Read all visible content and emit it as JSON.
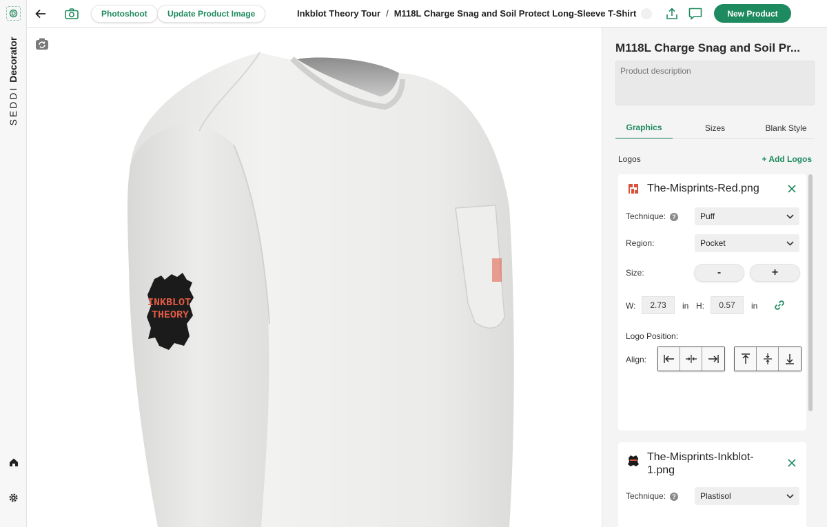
{
  "rail": {
    "brand_light": "SEDDI",
    "brand_bold": "Decorator"
  },
  "topbar": {
    "photoshoot_label": "Photoshoot",
    "update_image_label": "Update Product Image",
    "breadcrumb_collection": "Inkblot Theory Tour",
    "breadcrumb_separator": "/",
    "breadcrumb_product": "M118L Charge Snag and Soil Protect Long-Sleeve T-Shirt",
    "new_product_label": "New Product"
  },
  "viewer": {
    "sleeve_logo_line1": "INKBLOT",
    "sleeve_logo_line2": "THEORY"
  },
  "panel": {
    "title": "M118L Charge Snag and Soil Pr...",
    "description_placeholder": "Product description",
    "tabs": [
      {
        "label": "Graphics",
        "active": true
      },
      {
        "label": "Sizes",
        "active": false
      },
      {
        "label": "Blank Style",
        "active": false
      }
    ],
    "logos_label": "Logos",
    "add_logos_label": "+ Add Logos",
    "logos": [
      {
        "filename": "The-Misprints-Red.png",
        "technique_label": "Technique:",
        "technique": "Puff",
        "region_label": "Region:",
        "region": "Pocket",
        "size_label": "Size:",
        "minus": "-",
        "plus": "+",
        "w_label": "W:",
        "w_value": "2.73",
        "w_unit": "in",
        "h_label": "H:",
        "h_value": "0.57",
        "h_unit": "in",
        "position_label": "Logo Position:",
        "align_label": "Align:"
      },
      {
        "filename_line1": "The-Misprints-Inkblot-",
        "filename_line2": "1.png",
        "technique_label": "Technique:",
        "technique": "Plastisol"
      }
    ]
  },
  "colors": {
    "accent": "#1e8a5f",
    "logo_red": "#d9533b"
  }
}
